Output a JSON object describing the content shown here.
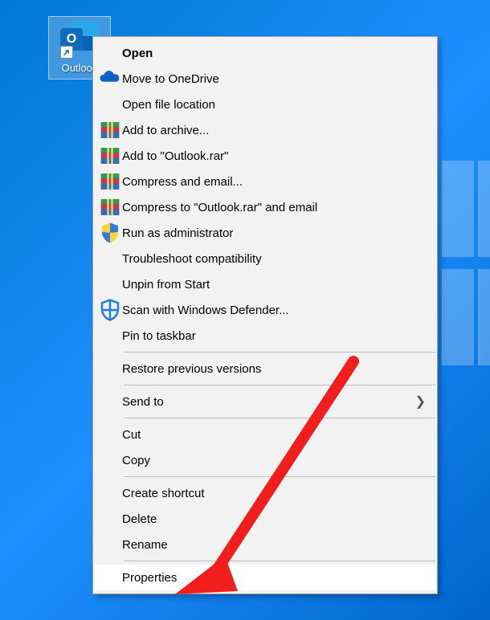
{
  "desktop": {
    "icon_label": "Outlook",
    "icon_letter": "O"
  },
  "context_menu": {
    "groups": [
      [
        {
          "id": "open",
          "label": "Open",
          "icon": null,
          "bold": true,
          "submenu": false
        },
        {
          "id": "onedrive",
          "label": "Move to OneDrive",
          "icon": "onedrive",
          "bold": false,
          "submenu": false
        },
        {
          "id": "open-location",
          "label": "Open file location",
          "icon": null,
          "bold": false,
          "submenu": false
        },
        {
          "id": "add-archive",
          "label": "Add to archive...",
          "icon": "winrar",
          "bold": false,
          "submenu": false
        },
        {
          "id": "add-outlook-rar",
          "label": "Add to \"Outlook.rar\"",
          "icon": "winrar",
          "bold": false,
          "submenu": false
        },
        {
          "id": "compress-email",
          "label": "Compress and email...",
          "icon": "winrar",
          "bold": false,
          "submenu": false
        },
        {
          "id": "compress-outlook-email",
          "label": "Compress to \"Outlook.rar\" and email",
          "icon": "winrar",
          "bold": false,
          "submenu": false
        },
        {
          "id": "run-admin",
          "label": "Run as administrator",
          "icon": "shield-uac",
          "bold": false,
          "submenu": false
        },
        {
          "id": "troubleshoot",
          "label": "Troubleshoot compatibility",
          "icon": null,
          "bold": false,
          "submenu": false
        },
        {
          "id": "unpin-start",
          "label": "Unpin from Start",
          "icon": null,
          "bold": false,
          "submenu": false
        },
        {
          "id": "defender",
          "label": "Scan with Windows Defender...",
          "icon": "defender",
          "bold": false,
          "submenu": false
        },
        {
          "id": "pin-taskbar",
          "label": "Pin to taskbar",
          "icon": null,
          "bold": false,
          "submenu": false
        }
      ],
      [
        {
          "id": "restore-versions",
          "label": "Restore previous versions",
          "icon": null,
          "bold": false,
          "submenu": false
        }
      ],
      [
        {
          "id": "send-to",
          "label": "Send to",
          "icon": null,
          "bold": false,
          "submenu": true
        }
      ],
      [
        {
          "id": "cut",
          "label": "Cut",
          "icon": null,
          "bold": false,
          "submenu": false
        },
        {
          "id": "copy",
          "label": "Copy",
          "icon": null,
          "bold": false,
          "submenu": false
        }
      ],
      [
        {
          "id": "create-shortcut",
          "label": "Create shortcut",
          "icon": null,
          "bold": false,
          "submenu": false
        },
        {
          "id": "delete",
          "label": "Delete",
          "icon": null,
          "bold": false,
          "submenu": false
        },
        {
          "id": "rename",
          "label": "Rename",
          "icon": null,
          "bold": false,
          "submenu": false
        }
      ],
      [
        {
          "id": "properties",
          "label": "Properties",
          "icon": null,
          "bold": false,
          "submenu": false,
          "hover": true
        }
      ]
    ]
  }
}
